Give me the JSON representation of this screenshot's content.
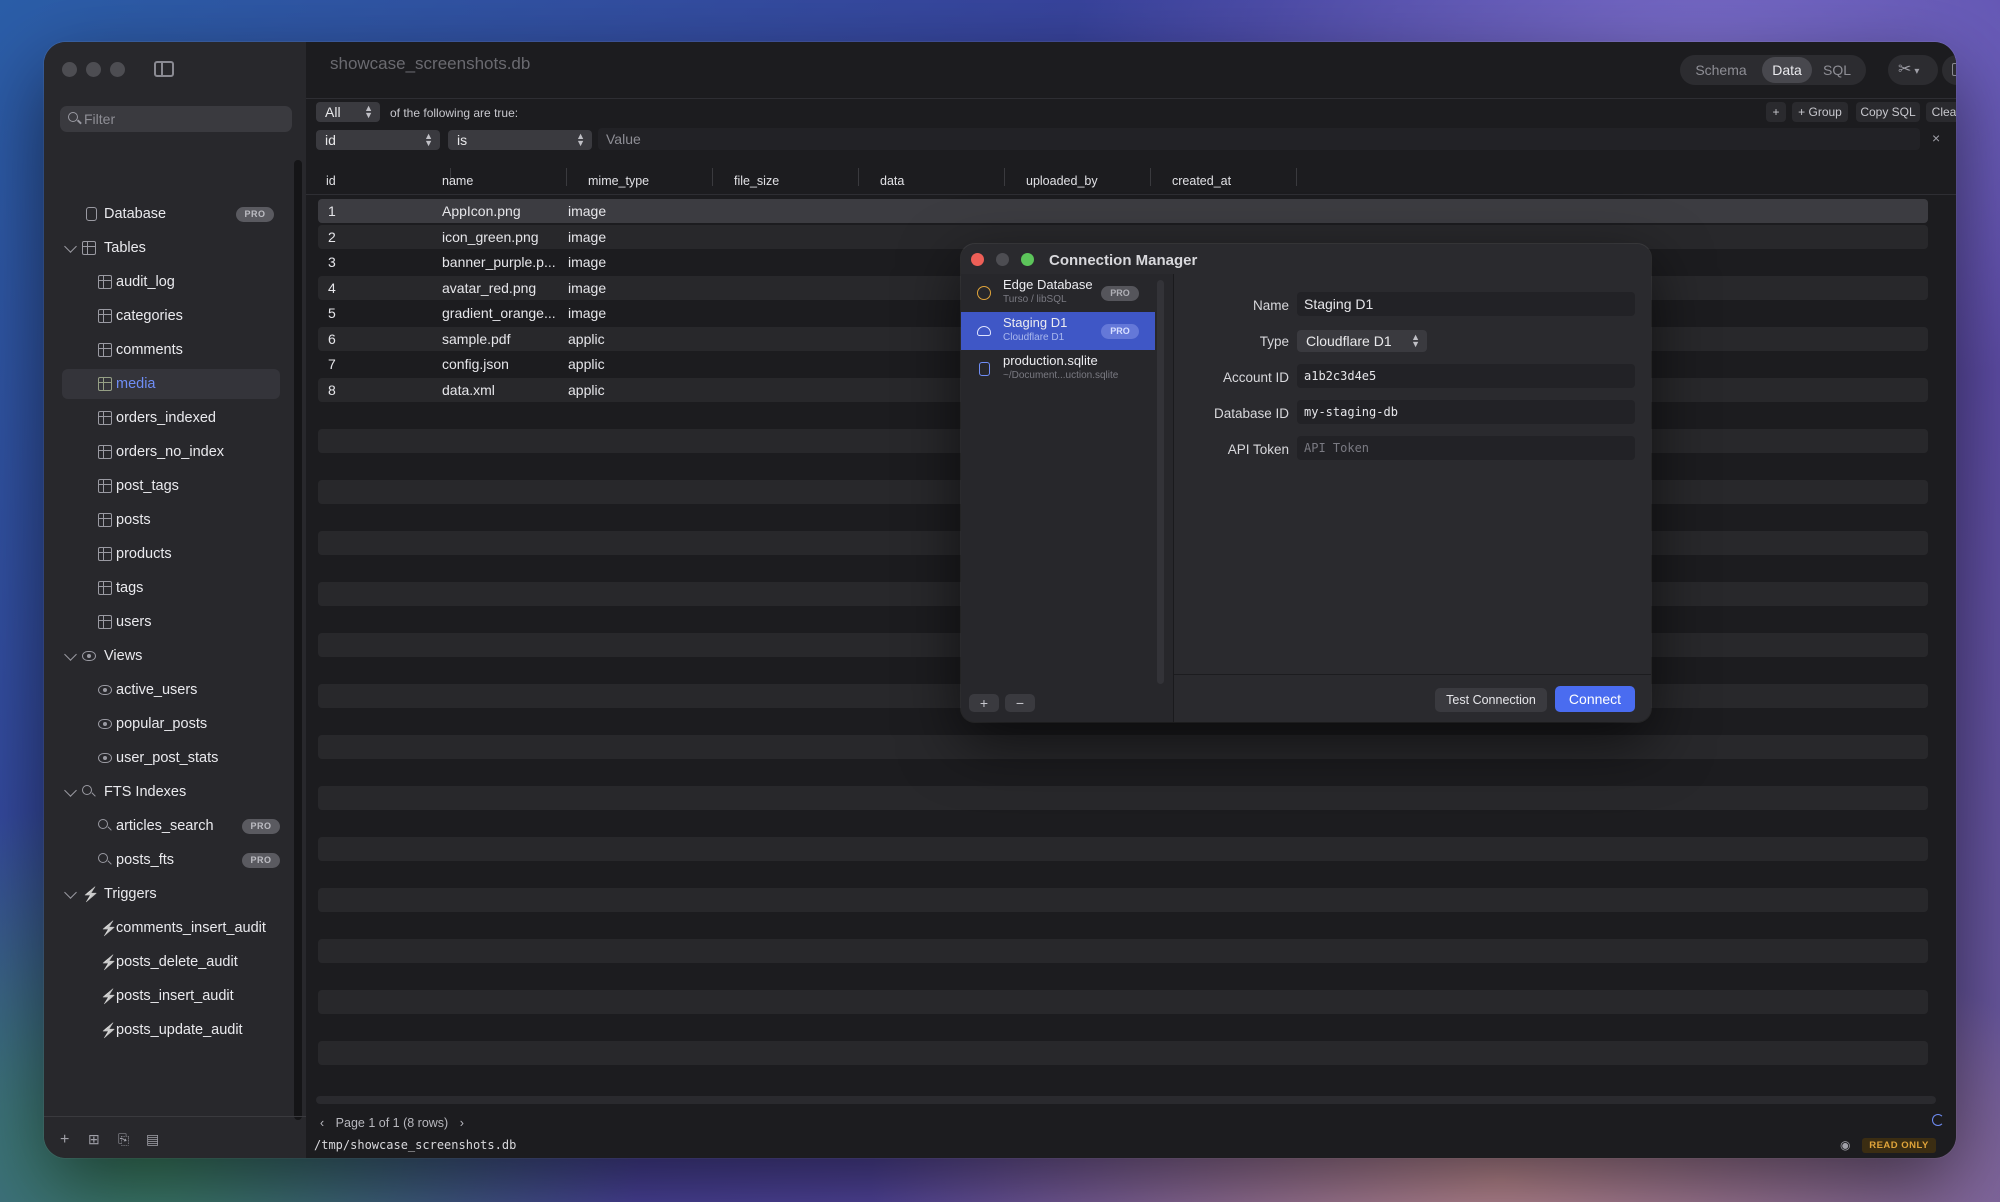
{
  "window": {
    "title": "showcase_screenshots.db"
  },
  "sidebar": {
    "filter_placeholder": "Filter",
    "database_label": "Database",
    "pro_badge": "PRO",
    "tables_header": "Tables",
    "tables": [
      "audit_log",
      "categories",
      "comments",
      "media",
      "orders_indexed",
      "orders_no_index",
      "post_tags",
      "posts",
      "products",
      "tags",
      "users"
    ],
    "selected_table": "media",
    "views_header": "Views",
    "views": [
      "active_users",
      "popular_posts",
      "user_post_stats"
    ],
    "fts_header": "FTS Indexes",
    "fts": [
      "articles_search",
      "posts_fts"
    ],
    "triggers_header": "Triggers",
    "triggers": [
      "comments_insert_audit",
      "posts_delete_audit",
      "posts_insert_audit",
      "posts_update_audit"
    ]
  },
  "toolbar": {
    "schema": "Schema",
    "data": "Data",
    "sql": "SQL"
  },
  "filter_bar": {
    "match": "All",
    "match_suffix": "of the following are true:",
    "field": "id",
    "op": "is",
    "value_placeholder": "Value",
    "add": "+",
    "group": "+ Group",
    "copy_sql": "Copy SQL",
    "clear_all": "Clear All",
    "remove": "×"
  },
  "table": {
    "columns": [
      "id",
      "name",
      "mime_type",
      "file_size",
      "data",
      "uploaded_by",
      "created_at"
    ],
    "rows": [
      [
        "1",
        "AppIcon.png",
        "image"
      ],
      [
        "2",
        "icon_green.png",
        "image"
      ],
      [
        "3",
        "banner_purple.p...",
        "image"
      ],
      [
        "4",
        "avatar_red.png",
        "image"
      ],
      [
        "5",
        "gradient_orange...",
        "image"
      ],
      [
        "6",
        "sample.pdf",
        "applic"
      ],
      [
        "7",
        "config.json",
        "applic"
      ],
      [
        "8",
        "data.xml",
        "applic"
      ]
    ]
  },
  "footer": {
    "pager": "Page 1 of 1 (8 rows)",
    "path": "/tmp/showcase_screenshots.db",
    "read_only": "READ ONLY"
  },
  "dialog": {
    "title": "Connection Manager",
    "connections": [
      {
        "name": "Edge Database",
        "sub": "Turso / libSQL",
        "pro": "PRO"
      },
      {
        "name": "Staging D1",
        "sub": "Cloudflare D1",
        "pro": "PRO"
      },
      {
        "name": "production.sqlite",
        "sub": "~/Document...uction.sqlite"
      }
    ],
    "form": {
      "name_label": "Name",
      "name_value": "Staging D1",
      "type_label": "Type",
      "type_value": "Cloudflare D1",
      "account_label": "Account ID",
      "account_value": "a1b2c3d4e5",
      "dbid_label": "Database ID",
      "dbid_value": "my-staging-db",
      "token_label": "API Token",
      "token_placeholder": "API Token"
    },
    "add": "+",
    "remove": "−",
    "test": "Test Connection",
    "connect": "Connect"
  },
  "colors": {
    "accent": "#3f57c6",
    "connect": "#4a6cf0",
    "readonly": "#e0a43a"
  }
}
